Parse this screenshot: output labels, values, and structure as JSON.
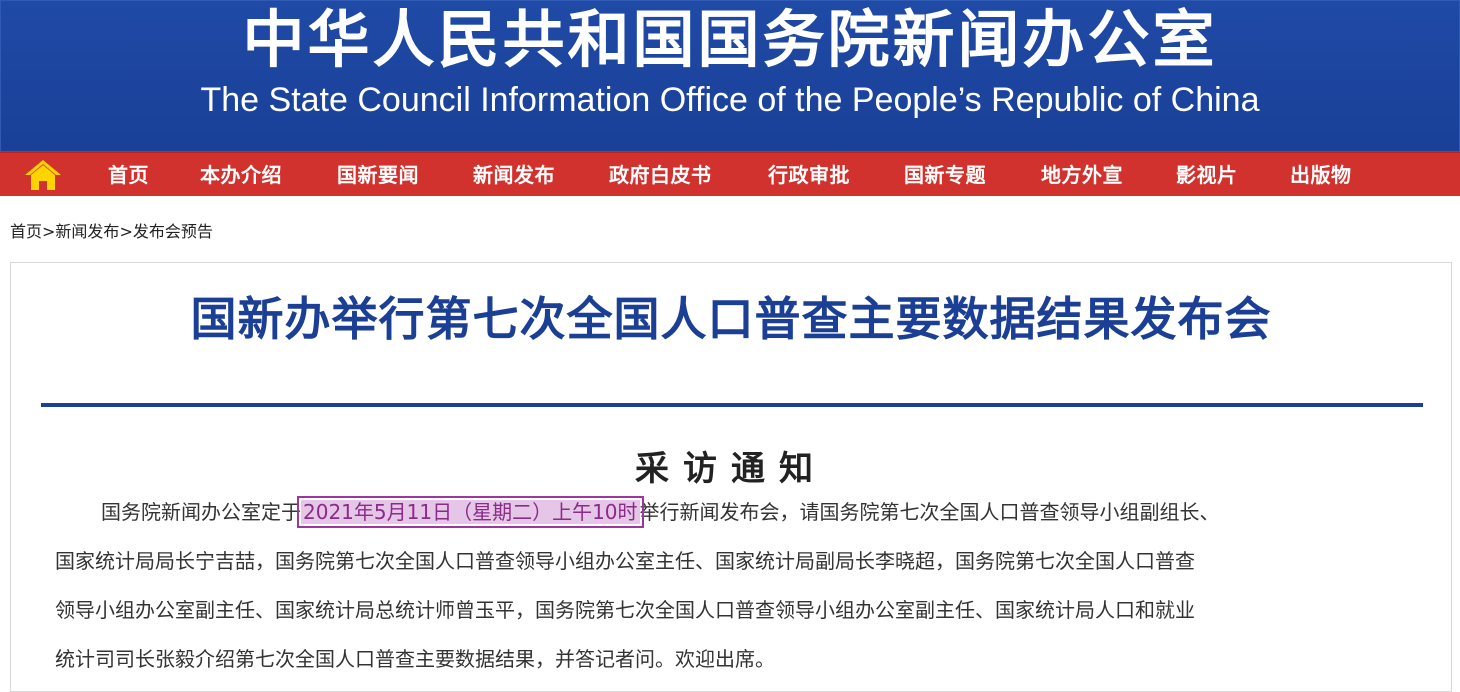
{
  "header": {
    "title_cn": "中华人民共和国国务院新闻办公室",
    "title_en": "The State Council Information Office of the People’s Republic of China",
    "bg_color": "#1f4aa6"
  },
  "nav": {
    "home_icon": "home-icon",
    "bg_color": "#d2322d",
    "items": [
      "首页",
      "本办介绍",
      "国新要闻",
      "新闻发布",
      "政府白皮书",
      "行政审批",
      "国新专题",
      "地方外宣",
      "影视片",
      "出版物"
    ]
  },
  "breadcrumb": {
    "items": [
      "首页",
      "新闻发布",
      "发布会预告"
    ],
    "separator": ">"
  },
  "article": {
    "title": "国新办举行第七次全国人口普查主要数据结果发布会",
    "title_color": "#1b3f95",
    "heading": "采访通知",
    "para_prefix": "国务院新闻办公室定于",
    "para_highlight": "2021年5月11日（星期二）上午10时",
    "para_line1_rest": "举行新闻发布会，请国务院第七次全国人口普查领导小组副组长、",
    "para_line2": "国家统计局局长宁吉喆，国务院第七次全国人口普查领导小组办公室主任、国家统计局副局长李晓超，国务院第七次全国人口普查",
    "para_line3": "领导小组办公室副主任、国家统计局总统计师曾玉平，国务院第七次全国人口普查领导小组办公室副主任、国家统计局人口和就业",
    "para_line4": "统计司司长张毅介绍第七次全国人口普查主要数据结果，并答记者问。欢迎出席。"
  }
}
